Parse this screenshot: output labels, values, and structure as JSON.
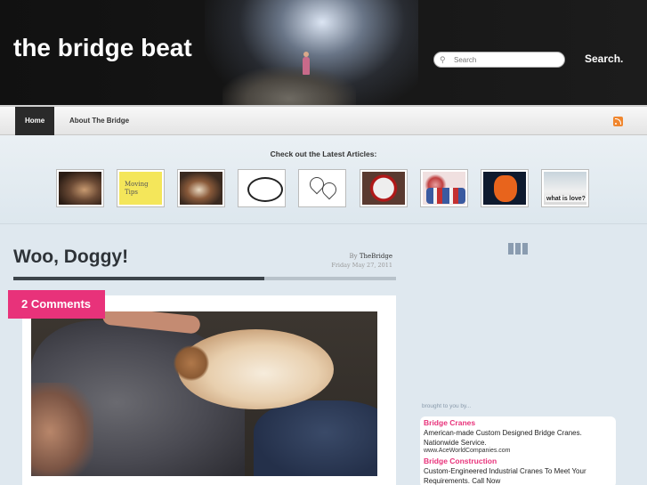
{
  "header": {
    "site_title": "the bridge beat",
    "search_placeholder": "Search",
    "search_button": "Search."
  },
  "nav": {
    "items": [
      {
        "label": "Home",
        "active": true
      },
      {
        "label": "About The Bridge",
        "active": false
      }
    ],
    "rss_icon": "rss-icon"
  },
  "featured": {
    "title": "Check out the Latest Articles:",
    "thumbs": [
      {
        "icon": "dog-couch-thumb"
      },
      {
        "icon": "sticky-note-thumb",
        "caption": "Moving Tips"
      },
      {
        "icon": "puppy-thumb"
      },
      {
        "icon": "thought-bubble-thumb"
      },
      {
        "icon": "hearts-doodle-thumb"
      },
      {
        "icon": "no-fighting-sign-thumb"
      },
      {
        "icon": "cupcakes-thumb"
      },
      {
        "icon": "bears-logo-thumb"
      },
      {
        "icon": "what-is-love-thumb",
        "caption": "what is love?"
      }
    ]
  },
  "post": {
    "title": "Woo, Doggy!",
    "by_label": "By",
    "author": "TheBridge",
    "date": "Friday May 27, 2011",
    "comments_label": "2 Comments"
  },
  "sidebar": {
    "ads_label": "brought to you by...",
    "ads": [
      {
        "title": "Bridge Cranes",
        "text": "American-made Custom Designed Bridge Cranes. Nationwide Service.",
        "url": "www.AceWorldCompanies.com"
      },
      {
        "title": "Bridge Construction",
        "text": "Custom-Engineered Industrial Cranes To Meet Your Requirements. Call Now"
      }
    ]
  },
  "colors": {
    "accent": "#e8327a",
    "header_bg": "#141414",
    "nav_active": "#2a2a2a"
  }
}
